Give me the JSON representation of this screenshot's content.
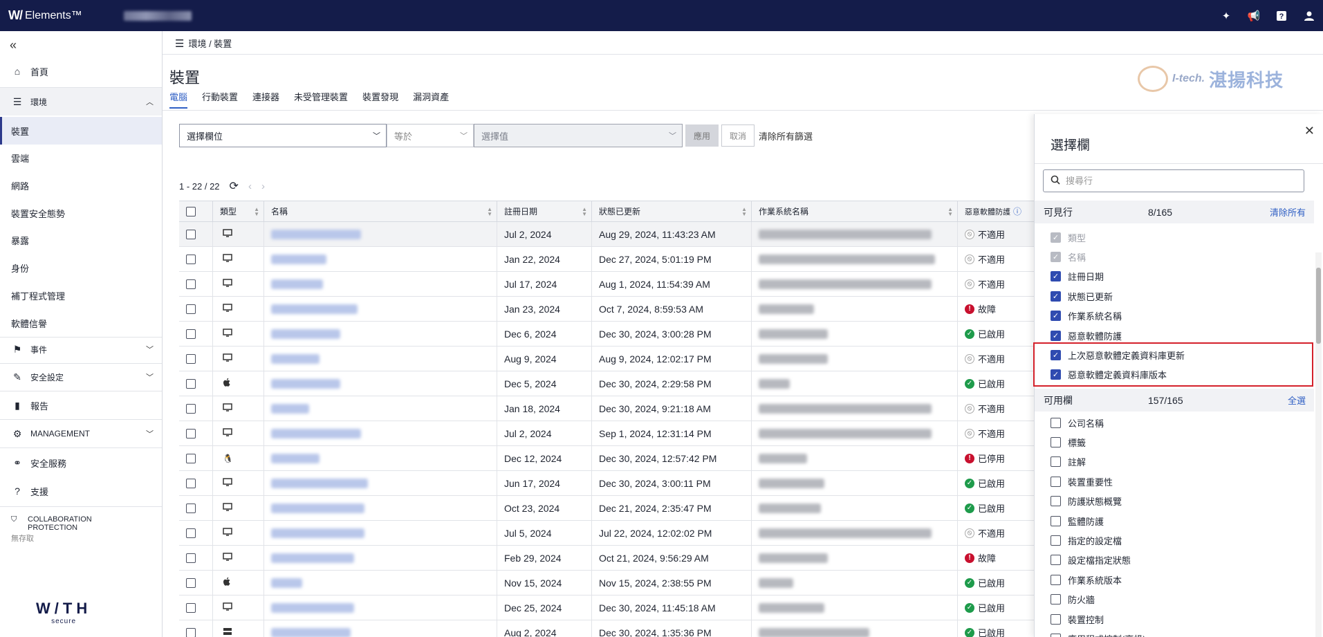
{
  "app": {
    "brand_mark": "W/",
    "brand_name": "Elements™"
  },
  "sidebar": {
    "home": "首頁",
    "env": "環境",
    "env_items": [
      "裝置",
      "雲端",
      "網路",
      "裝置安全態勢",
      "暴露",
      "身份",
      "補丁程式管理",
      "軟體信譽"
    ],
    "events": "事件",
    "security_settings": "安全設定",
    "reports": "報告",
    "management": "MANAGEMENT",
    "security_services": "安全服務",
    "support": "支援",
    "collab_line1": "COLLABORATION",
    "collab_line2": "PROTECTION",
    "collab_sub": "無存取",
    "logo_big": "W/TH",
    "logo_small": "secure"
  },
  "breadcrumb": "環境 / 裝置",
  "page": {
    "title": "裝置"
  },
  "tabs": [
    "電腦",
    "行動裝置",
    "連接器",
    "未受管理裝置",
    "裝置發現",
    "漏洞資產"
  ],
  "watermark": {
    "brand": "I-tech.",
    "cn": "湛揚科技"
  },
  "filter": {
    "field_placeholder": "選擇欄位",
    "operator": "等於",
    "value_placeholder": "選擇值",
    "apply": "應用",
    "cancel": "取消",
    "clear_all": "清除所有篩選"
  },
  "pager": {
    "range": "1 - 22 / 22"
  },
  "table": {
    "headers": [
      "類型",
      "名稱",
      "註冊日期",
      "狀態已更新",
      "作業系統名稱",
      "惡意軟體防護"
    ],
    "rows": [
      {
        "type": "pc",
        "reg": "Jul 2, 2024",
        "upd": "Aug 29, 2024, 11:43:23 AM",
        "status": "na",
        "status_text": "不適用"
      },
      {
        "type": "pc",
        "reg": "Jan 22, 2024",
        "upd": "Dec 27, 2024, 5:01:19 PM",
        "status": "na",
        "status_text": "不適用"
      },
      {
        "type": "pc",
        "reg": "Jul 17, 2024",
        "upd": "Aug 1, 2024, 11:54:39 AM",
        "status": "na",
        "status_text": "不適用"
      },
      {
        "type": "pc",
        "reg": "Jan 23, 2024",
        "upd": "Oct 7, 2024, 8:59:53 AM",
        "status": "err",
        "status_text": "故障"
      },
      {
        "type": "pc",
        "reg": "Dec 6, 2024",
        "upd": "Dec 30, 2024, 3:00:28 PM",
        "status": "ok",
        "status_text": "已啟用"
      },
      {
        "type": "pc",
        "reg": "Aug 9, 2024",
        "upd": "Aug 9, 2024, 12:02:17 PM",
        "status": "na",
        "status_text": "不適用"
      },
      {
        "type": "apple",
        "reg": "Dec 5, 2024",
        "upd": "Dec 30, 2024, 2:29:58 PM",
        "status": "ok",
        "status_text": "已啟用"
      },
      {
        "type": "pc",
        "reg": "Jan 18, 2024",
        "upd": "Dec 30, 2024, 9:21:18 AM",
        "status": "na",
        "status_text": "不適用"
      },
      {
        "type": "pc",
        "reg": "Jul 2, 2024",
        "upd": "Sep 1, 2024, 12:31:14 PM",
        "status": "na",
        "status_text": "不適用"
      },
      {
        "type": "linux",
        "reg": "Dec 12, 2024",
        "upd": "Dec 30, 2024, 12:57:42 PM",
        "status": "err",
        "status_text": "已停用"
      },
      {
        "type": "pc",
        "reg": "Jun 17, 2024",
        "upd": "Dec 30, 2024, 3:00:11 PM",
        "status": "ok",
        "status_text": "已啟用"
      },
      {
        "type": "pc",
        "reg": "Oct 23, 2024",
        "upd": "Dec 21, 2024, 2:35:47 PM",
        "status": "ok",
        "status_text": "已啟用"
      },
      {
        "type": "pc",
        "reg": "Jul 5, 2024",
        "upd": "Jul 22, 2024, 12:02:02 PM",
        "status": "na",
        "status_text": "不適用"
      },
      {
        "type": "pc",
        "reg": "Feb 29, 2024",
        "upd": "Oct 21, 2024, 9:56:29 AM",
        "status": "err",
        "status_text": "故障"
      },
      {
        "type": "apple",
        "reg": "Nov 15, 2024",
        "upd": "Nov 15, 2024, 2:38:55 PM",
        "status": "ok",
        "status_text": "已啟用"
      },
      {
        "type": "pc",
        "reg": "Dec 25, 2024",
        "upd": "Dec 30, 2024, 11:45:18 AM",
        "status": "ok",
        "status_text": "已啟用"
      },
      {
        "type": "server",
        "reg": "Aug 2, 2024",
        "upd": "Dec 30, 2024, 1:35:36 PM",
        "status": "ok",
        "status_text": "已啟用"
      }
    ]
  },
  "panel": {
    "title": "選擇欄",
    "search_placeholder": "搜尋行",
    "visible_label": "可見行",
    "visible_count": "8/165",
    "visible_action": "清除所有",
    "visible": [
      {
        "label": "類型",
        "state": "dis"
      },
      {
        "label": "名稱",
        "state": "dis"
      },
      {
        "label": "註冊日期",
        "state": "on"
      },
      {
        "label": "狀態已更新",
        "state": "on"
      },
      {
        "label": "作業系統名稱",
        "state": "on"
      },
      {
        "label": "惡意軟體防護",
        "state": "on"
      },
      {
        "label": "上次惡意軟體定義資料庫更新",
        "state": "on"
      },
      {
        "label": "惡意軟體定義資料庫版本",
        "state": "on"
      }
    ],
    "available_label": "可用欄",
    "available_count": "157/165",
    "available_action": "全選",
    "available": [
      "公司名稱",
      "標籤",
      "註解",
      "裝置重要性",
      "防護狀態概覽",
      "監體防護",
      "指定的設定檔",
      "設定檔指定狀態",
      "作業系統版本",
      "防火牆",
      "裝置控制",
      "應用程式控制(高級)"
    ]
  },
  "colors": {
    "topbar": "#141c4a",
    "accent": "#2f5fc4",
    "ok": "#1e9b4b",
    "error": "#c8102e",
    "highlight": "#d4202a"
  }
}
